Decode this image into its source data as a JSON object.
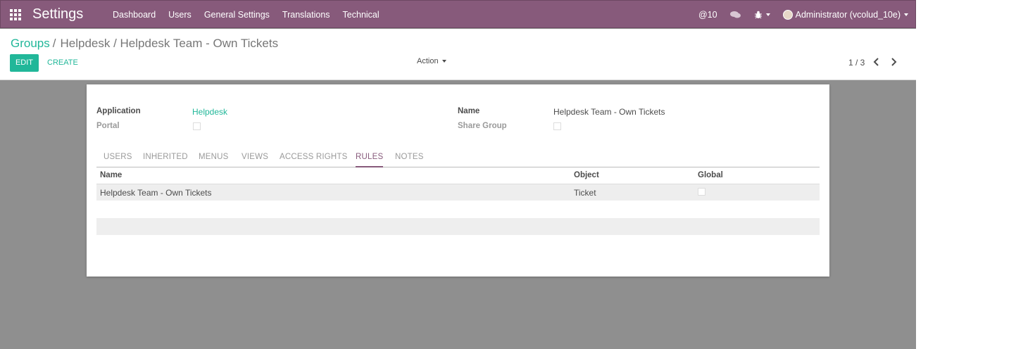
{
  "topbar": {
    "app_title": "Settings",
    "menu": [
      "Dashboard",
      "Users",
      "General Settings",
      "Translations",
      "Technical"
    ],
    "mentions": "@10",
    "user": "Administrator (vcolud_10e)"
  },
  "breadcrumb": {
    "root": "Groups",
    "current": "Helpdesk / Helpdesk Team - Own Tickets"
  },
  "buttons": {
    "edit": "EDIT",
    "create": "CREATE",
    "action": "Action"
  },
  "pager": {
    "value": "1 / 3"
  },
  "form": {
    "application_label": "Application",
    "application_value": "Helpdesk",
    "portal_label": "Portal",
    "name_label": "Name",
    "name_value": "Helpdesk Team - Own Tickets",
    "share_group_label": "Share Group"
  },
  "tabs": [
    "USERS",
    "INHERITED",
    "MENUS",
    "VIEWS",
    "ACCESS RIGHTS",
    "RULES",
    "NOTES"
  ],
  "active_tab": "RULES",
  "table": {
    "columns": [
      "Name",
      "Object",
      "Global"
    ],
    "rows": [
      {
        "name": "Helpdesk Team - Own Tickets",
        "object": "Ticket",
        "global": false
      }
    ]
  },
  "colors": {
    "brand": "#875a7b",
    "accent": "#21b799"
  }
}
